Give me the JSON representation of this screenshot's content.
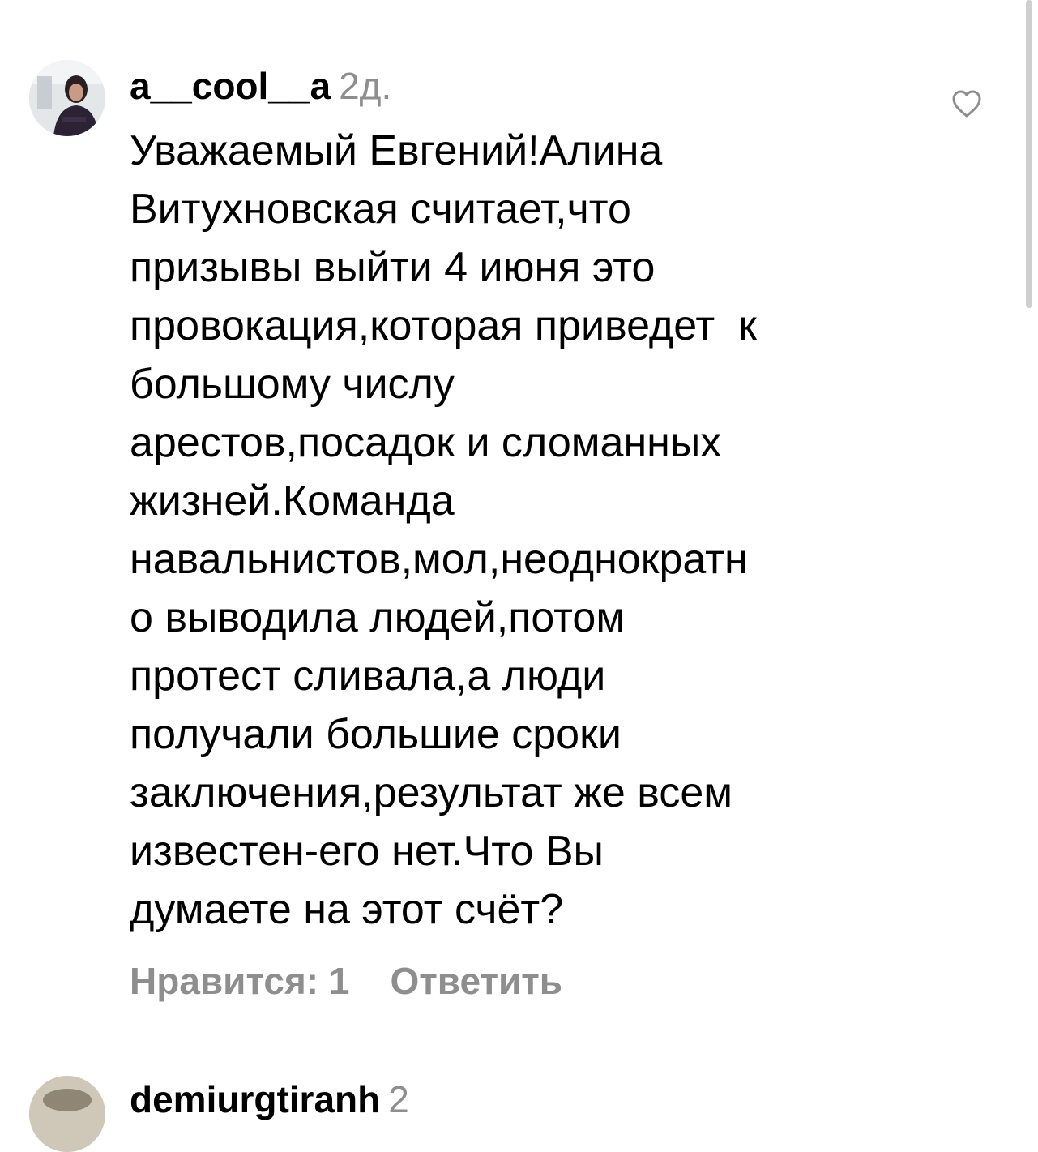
{
  "comment": {
    "username": "a__cool__a",
    "time": "2д.",
    "text": "Уважаемый Евгений!Алина\nВитухновская считает,что\nпризывы выйти 4 июня это\nпровокация,которая приведет  к\nбольшому числу\nарестов,посадок и сломанных\nжизней.Команда\nнавальнистов,мол,неоднократн\nо выводила людей,потом\nпротест сливала,а люди\nполучали большие сроки\nзаключения,результат же всем\nизвестен-его нет.Что Вы\nдумаете на этот счёт?",
    "likes_label": "Нравится: 1",
    "reply_label": "Ответить",
    "like_icon": "heart-outline-icon"
  },
  "next_comment": {
    "username": "demiurgtiranh",
    "time": "2"
  },
  "colors": {
    "text": "#000000",
    "secondary": "#8e8e8e",
    "background": "#ffffff"
  }
}
